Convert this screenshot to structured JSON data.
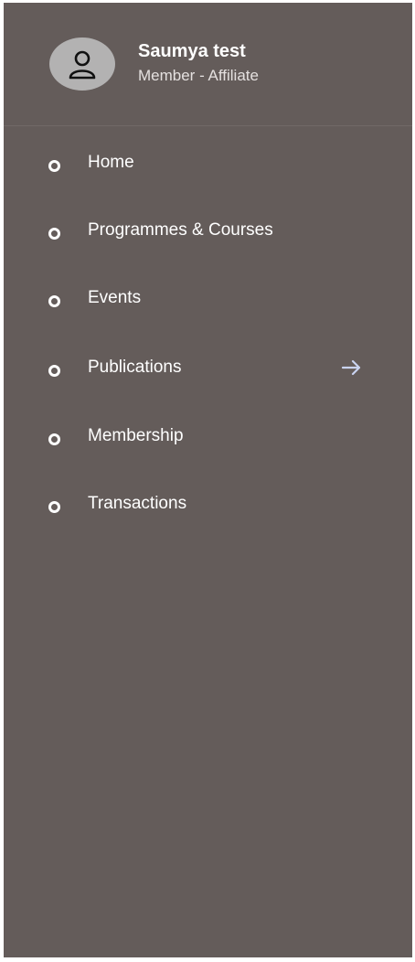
{
  "profile": {
    "name": "Saumya test",
    "role": "Member - Affiliate",
    "avatar_icon": "user-outline-icon"
  },
  "menu": {
    "items": [
      {
        "label": "Home",
        "icon": "circle-bullet-icon"
      },
      {
        "label": "Programmes & Courses",
        "icon": "circle-bullet-icon"
      },
      {
        "label": "Events",
        "icon": "circle-bullet-icon"
      },
      {
        "label": "Publications",
        "icon": "circle-bullet-icon",
        "trailing_icon": "arrow-right-icon"
      },
      {
        "label": "Membership",
        "icon": "circle-bullet-icon"
      },
      {
        "label": "Transactions",
        "icon": "circle-bullet-icon"
      }
    ]
  },
  "colors": {
    "drawer_background": "#645c5a",
    "avatar_background": "#b3b2b2",
    "text": "#ffffff",
    "subtext": "#e4e0df",
    "arrow": "#c9d3f0"
  }
}
